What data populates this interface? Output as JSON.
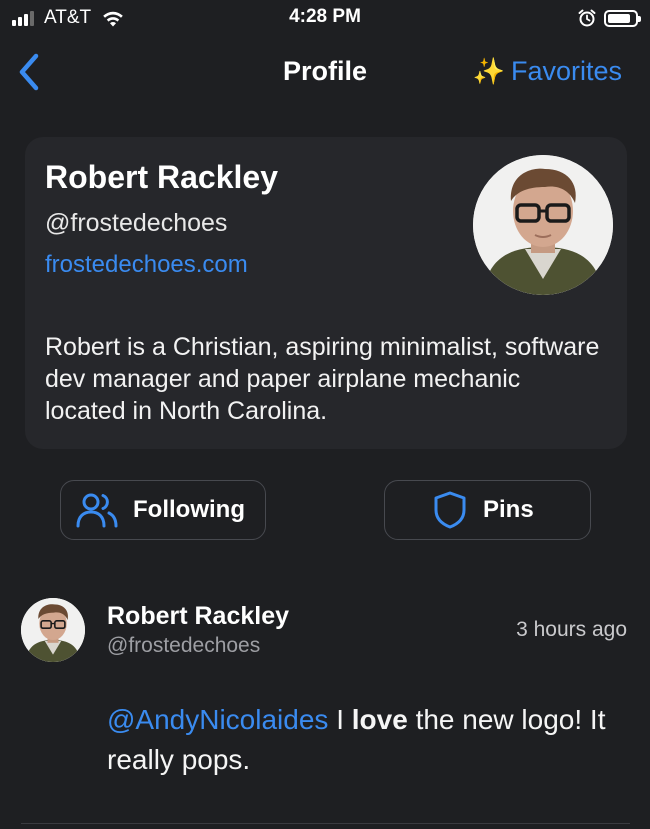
{
  "status_bar": {
    "carrier": "AT&T",
    "time": "4:28 PM"
  },
  "nav": {
    "title": "Profile",
    "favorites_icon": "✨",
    "favorites_label": "Favorites"
  },
  "profile": {
    "name": "Robert Rackley",
    "handle": "@frostedechoes",
    "website": "frostedechoes.com",
    "bio": "Robert is a Christian, aspiring minimalist, software dev manager and paper airplane mechanic located in North Carolina."
  },
  "actions": {
    "following_label": "Following",
    "pins_label": "Pins"
  },
  "post": {
    "author_name": "Robert Rackley",
    "author_handle": "@frostedechoes",
    "timestamp": "3 hours ago",
    "mention": "@AndyNicolaides",
    "text_before_bold": " I ",
    "bold_word": "love",
    "text_after_bold": " the new logo!  It really pops."
  },
  "colors": {
    "background": "#1e1f22",
    "card": "#26272b",
    "accent": "#3a8bf0"
  }
}
